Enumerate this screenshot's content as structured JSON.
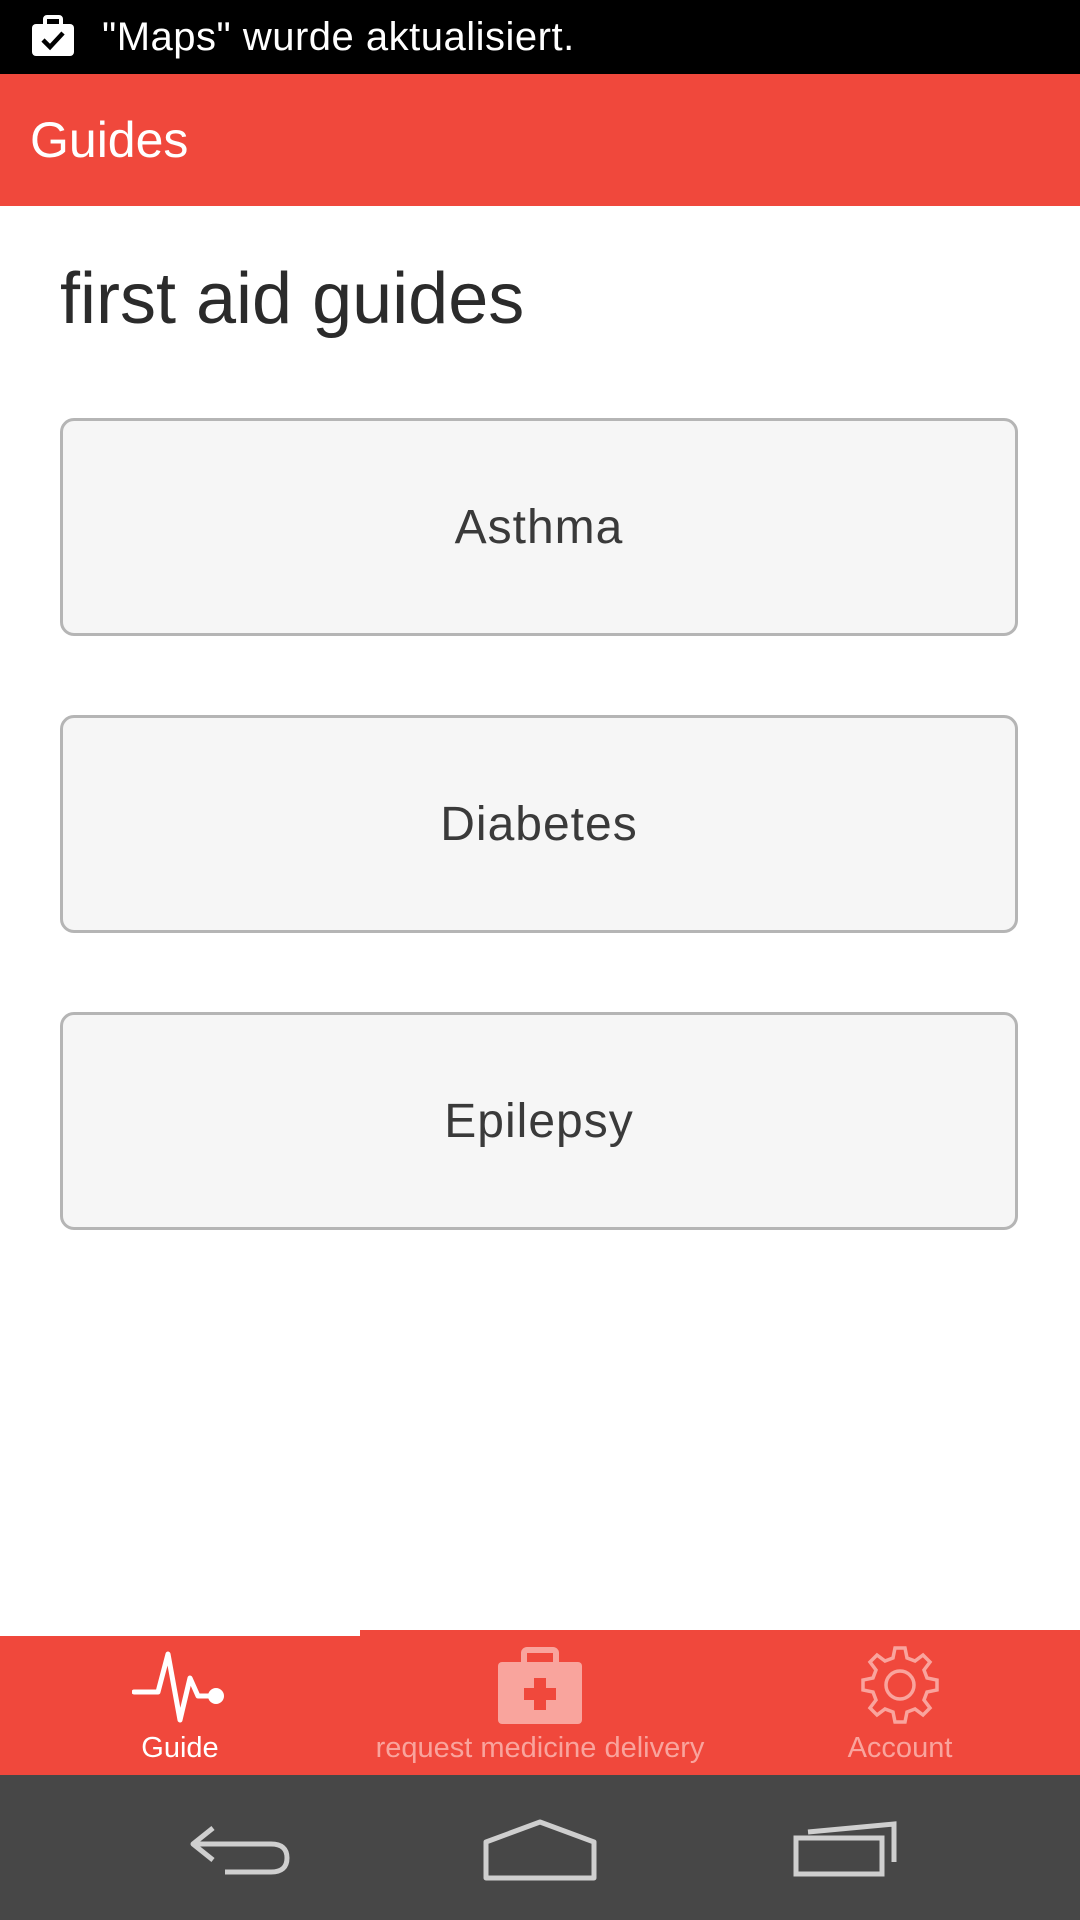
{
  "status_bar": {
    "notification_text": "\"Maps\" wurde aktualisiert.",
    "notification_icon": "briefcase-check-icon"
  },
  "app_bar": {
    "title": "Guides"
  },
  "main": {
    "heading": "first aid guides",
    "guides": [
      {
        "label": "Asthma"
      },
      {
        "label": "Diabetes"
      },
      {
        "label": "Epilepsy"
      }
    ]
  },
  "tabs": [
    {
      "label": "Guide",
      "icon": "heartbeat-icon",
      "active": true
    },
    {
      "label": "request medicine delivery",
      "icon": "medical-kit-icon",
      "active": false
    },
    {
      "label": "Account",
      "icon": "gear-icon",
      "active": false
    }
  ],
  "nav": {
    "back_icon": "back-arrow-icon",
    "home_icon": "home-icon",
    "recents_icon": "recent-apps-icon"
  },
  "colors": {
    "accent": "#f0483c",
    "status_bar": "#000000",
    "nav_bar": "#474747",
    "inactive_tab": "#f9a49d"
  }
}
